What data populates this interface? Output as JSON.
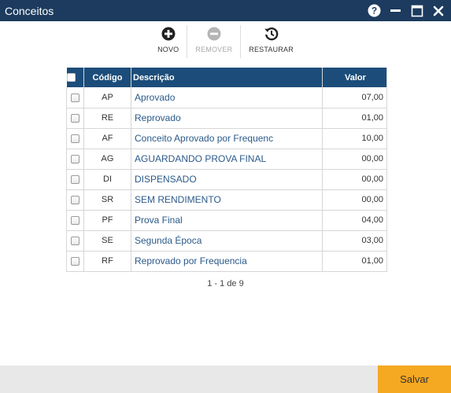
{
  "window": {
    "title": "Conceitos",
    "controls": [
      "help-icon",
      "minimize-icon",
      "maximize-icon",
      "close-icon"
    ]
  },
  "toolbar": {
    "novo_label": "NOVO",
    "remover_label": "REMOVER",
    "restaurar_label": "RESTAURAR"
  },
  "table": {
    "headers": {
      "codigo": "Código",
      "descricao": "Descrição",
      "valor": "Valor"
    },
    "rows": [
      {
        "codigo": "AP",
        "descricao": "Aprovado",
        "valor": "07,00"
      },
      {
        "codigo": "RE",
        "descricao": "Reprovado",
        "valor": "01,00"
      },
      {
        "codigo": "AF",
        "descricao": "Conceito Aprovado por Frequenc",
        "valor": "10,00"
      },
      {
        "codigo": "AG",
        "descricao": "AGUARDANDO PROVA FINAL",
        "valor": "00,00"
      },
      {
        "codigo": "DI",
        "descricao": "DISPENSADO",
        "valor": "00,00"
      },
      {
        "codigo": "SR",
        "descricao": "SEM RENDIMENTO",
        "valor": "00,00"
      },
      {
        "codigo": "PF",
        "descricao": "Prova Final",
        "valor": "04,00"
      },
      {
        "codigo": "SE",
        "descricao": "Segunda Época",
        "valor": "03,00"
      },
      {
        "codigo": "RF",
        "descricao": "Reprovado por Frequencia",
        "valor": "01,00"
      }
    ]
  },
  "pager": {
    "text": "1 - 1 de 9"
  },
  "footer": {
    "save_label": "Salvar"
  },
  "colors": {
    "titlebar": "#1c3b5e",
    "header": "#1c4d7a",
    "accent_save": "#f5a821",
    "link_text": "#2b5a8a"
  }
}
